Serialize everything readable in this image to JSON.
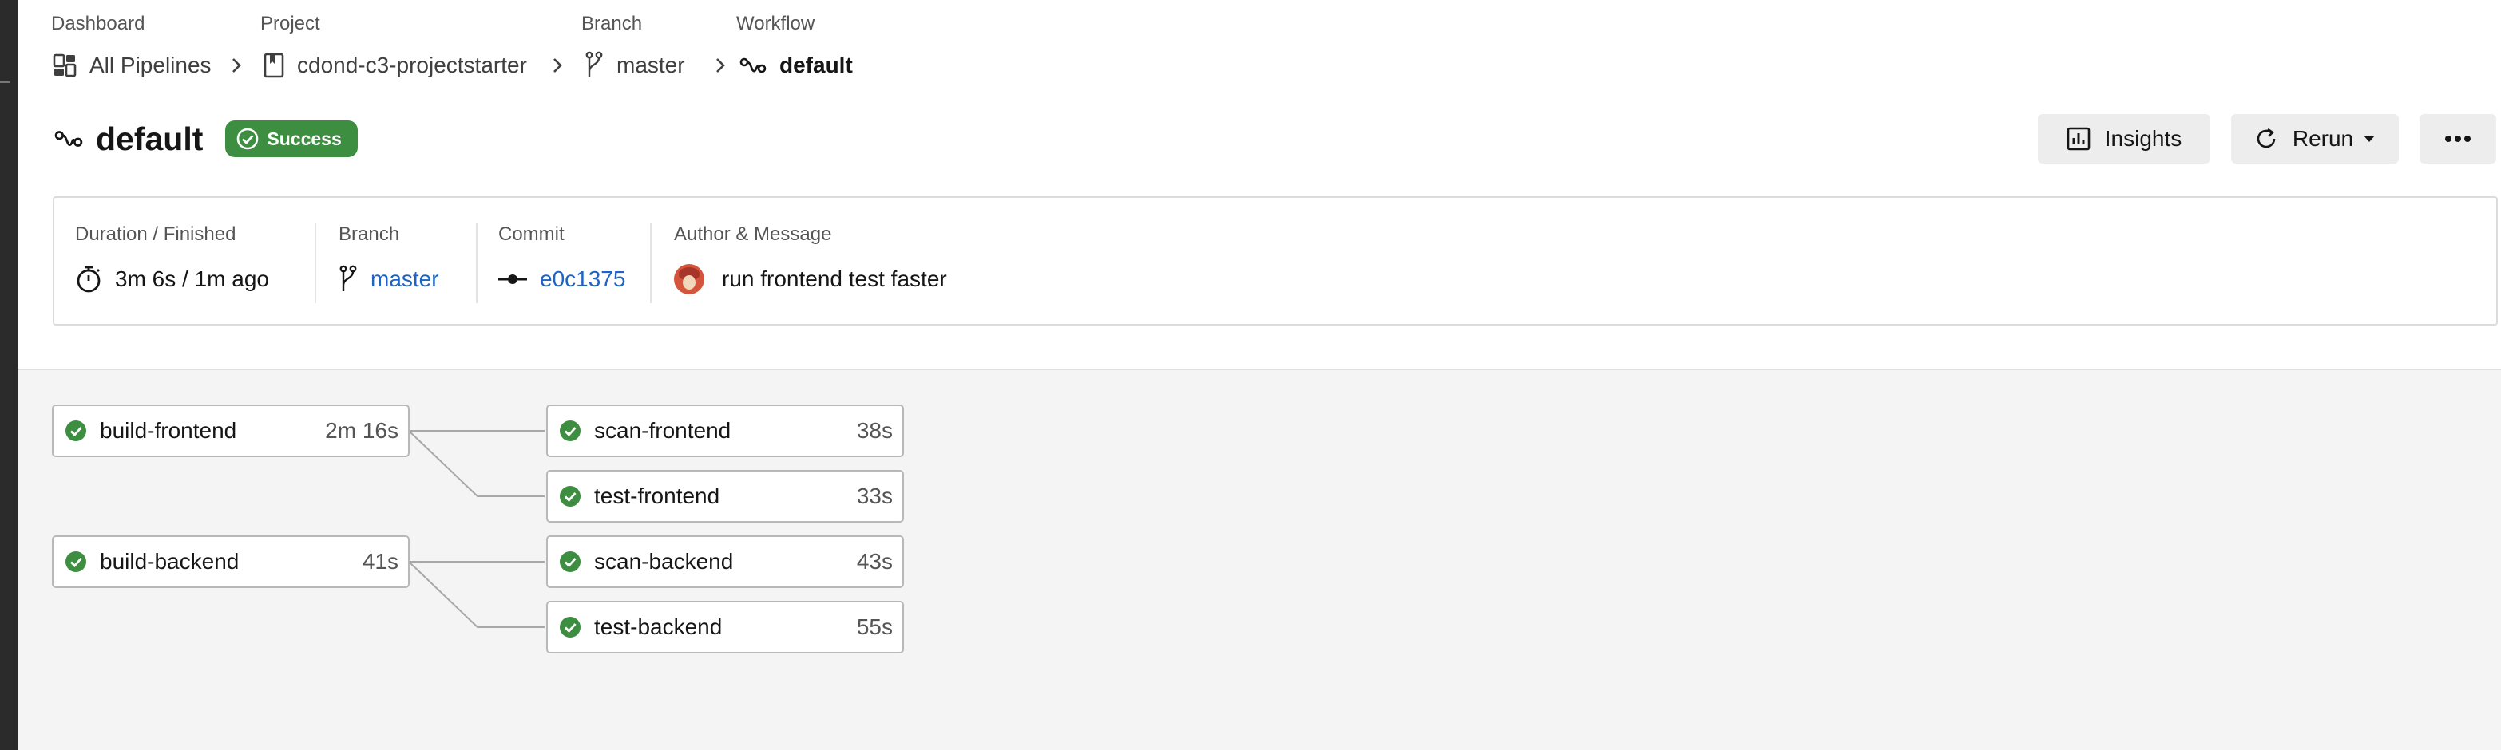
{
  "breadcrumb": {
    "dashboard": {
      "label": "Dashboard",
      "value": "All Pipelines"
    },
    "project": {
      "label": "Project",
      "value": "cdond-c3-projectstarter"
    },
    "branch": {
      "label": "Branch",
      "value": "master"
    },
    "workflow": {
      "label": "Workflow",
      "value": "default"
    }
  },
  "workflow": {
    "title": "default",
    "status": "Success",
    "status_color": "#3e8e41"
  },
  "actions": {
    "insights": "Insights",
    "rerun": "Rerun",
    "more": "more-options"
  },
  "summary": {
    "duration_label": "Duration / Finished",
    "duration_value": "3m 6s / 1m ago",
    "branch_label": "Branch",
    "branch_value": "master",
    "commit_label": "Commit",
    "commit_value": "e0c1375",
    "author_label": "Author & Message",
    "message": "run frontend test faster"
  },
  "jobs": [
    {
      "name": "build-frontend",
      "duration": "2m 16s",
      "status": "success"
    },
    {
      "name": "scan-frontend",
      "duration": "38s",
      "status": "success"
    },
    {
      "name": "test-frontend",
      "duration": "33s",
      "status": "success"
    },
    {
      "name": "build-backend",
      "duration": "41s",
      "status": "success"
    },
    {
      "name": "scan-backend",
      "duration": "43s",
      "status": "success"
    },
    {
      "name": "test-backend",
      "duration": "55s",
      "status": "success"
    }
  ],
  "colors": {
    "success": "#3e8e41",
    "link": "#1c64c8",
    "graph_bg": "#f4f4f4"
  },
  "icons": {
    "dashboard": "dashboard-grid-icon",
    "project": "bookmark-icon",
    "branch": "git-branch-icon",
    "workflow": "workflow-icon",
    "insights": "bar-chart-icon",
    "rerun": "refresh-icon",
    "duration": "stopwatch-icon",
    "commit": "git-commit-icon",
    "job_status": "check-circle-icon"
  }
}
